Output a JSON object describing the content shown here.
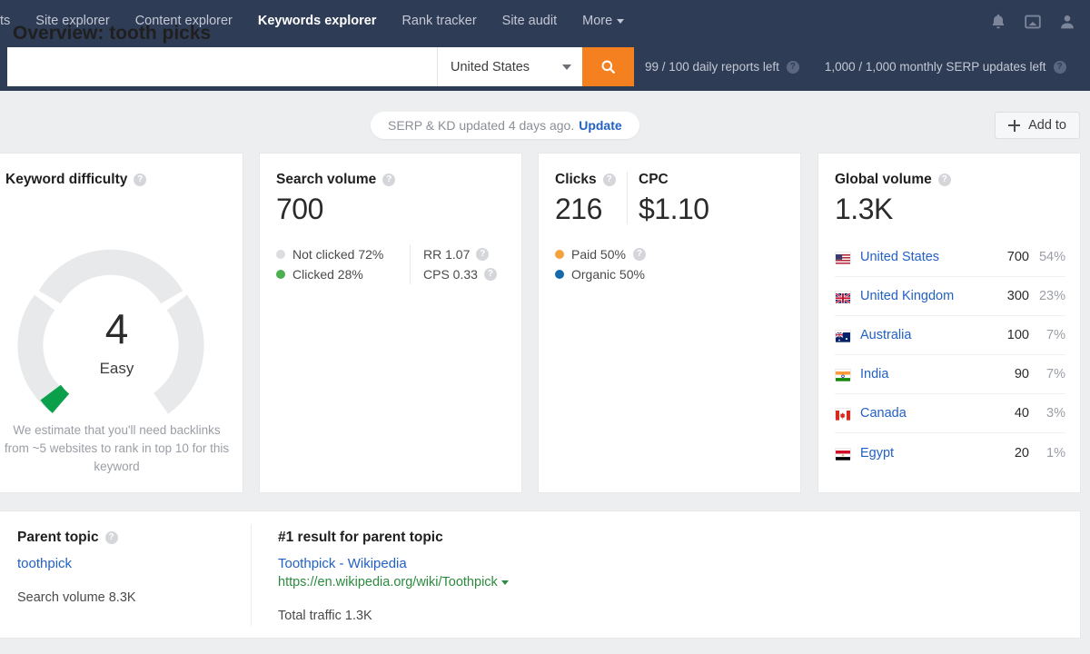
{
  "nav": {
    "items": [
      {
        "label": "ts",
        "active": false
      },
      {
        "label": "Site explorer",
        "active": false
      },
      {
        "label": "Content explorer",
        "active": false
      },
      {
        "label": "Keywords explorer",
        "active": true
      },
      {
        "label": "Rank tracker",
        "active": false
      },
      {
        "label": "Site audit",
        "active": false
      },
      {
        "label": "More",
        "active": false,
        "caret": true
      }
    ],
    "icons": [
      "bell-icon",
      "message-icon",
      "account-icon"
    ]
  },
  "search": {
    "keyword_value": "",
    "keyword_placeholder": "",
    "country": "United States",
    "button_icon": "search-icon",
    "daily_quota": "99 / 100 daily reports left",
    "monthly_quota": "1,000 / 1,000 monthly SERP updates left"
  },
  "header": {
    "title": "Overview: tooth picks",
    "serp_notice": "SERP & KD updated 4 days ago.",
    "update_link": "Update",
    "add_to": "Add to"
  },
  "keyword_difficulty": {
    "title": "Keyword difficulty",
    "value": "4",
    "label": "Easy",
    "note": "We estimate that you'll need backlinks from ~5 websites to rank in top 10 for this keyword",
    "fill_color": "#0aa04b",
    "track_color": "#e8e9eb"
  },
  "search_volume": {
    "title": "Search volume",
    "value": "700",
    "legend": [
      {
        "label": "Not clicked 72%",
        "color": "#dcdde0"
      },
      {
        "label": "Clicked 28%",
        "color": "#4caf50"
      }
    ],
    "metrics": [
      {
        "label": "RR 1.07",
        "help": true
      },
      {
        "label": "CPS 0.33",
        "help": true
      }
    ]
  },
  "clicks": {
    "clicks_title": "Clicks",
    "clicks_value": "216",
    "cpc_title": "CPC",
    "cpc_value": "$1.10",
    "legend": [
      {
        "label": "Paid 50%",
        "color": "#f3a23c",
        "help": true
      },
      {
        "label": "Organic 50%",
        "color": "#1769aa",
        "help": false
      }
    ]
  },
  "global_volume": {
    "title": "Global volume",
    "value": "1.3K",
    "countries": [
      {
        "name": "United States",
        "volume": "700",
        "percent": "54%",
        "flag": "us"
      },
      {
        "name": "United Kingdom",
        "volume": "300",
        "percent": "23%",
        "flag": "uk"
      },
      {
        "name": "Australia",
        "volume": "100",
        "percent": "7%",
        "flag": "au"
      },
      {
        "name": "India",
        "volume": "90",
        "percent": "7%",
        "flag": "in"
      },
      {
        "name": "Canada",
        "volume": "40",
        "percent": "3%",
        "flag": "ca"
      },
      {
        "name": "Egypt",
        "volume": "20",
        "percent": "1%",
        "flag": "eg"
      }
    ]
  },
  "parent_topic": {
    "title": "Parent topic",
    "topic": "toothpick",
    "volume_line": "Search volume 8.3K"
  },
  "top_result": {
    "title": "#1 result for parent topic",
    "page_title": "Toothpick - Wikipedia",
    "url": "https://en.wikipedia.org/wiki/Toothpick",
    "traffic_line": "Total traffic 1.3K"
  }
}
